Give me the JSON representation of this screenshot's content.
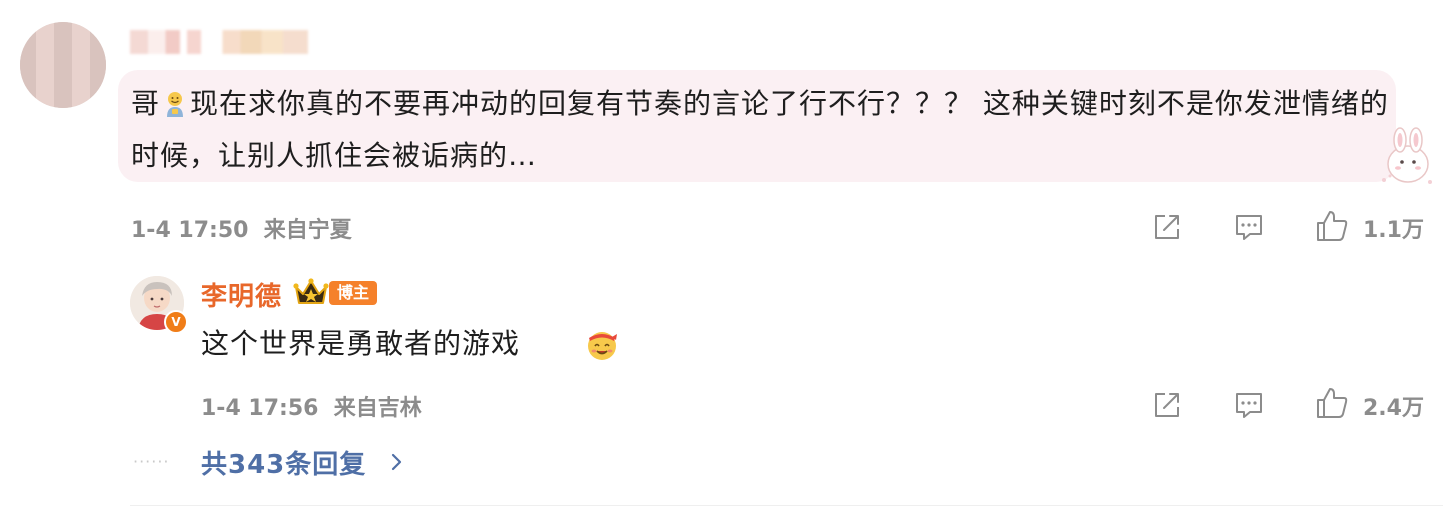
{
  "comment": {
    "text_part1": "哥",
    "text_part2": "现在求你真的不要再冲动的回复有节奏的言论了行不行？？？ 这种关键时刻不是你发泄情绪的时候，让别人抓住会被诟病的…",
    "time": "1-4 17:50",
    "location": "来自宁夏",
    "likes": "1.1万",
    "icons": {
      "share": "share-icon",
      "comment": "comment-icon",
      "like": "like-icon",
      "emoji": "smiling-emoji-icon"
    }
  },
  "reply": {
    "author": "李明德",
    "badge": "博主",
    "verified_mark": "V",
    "text": "这个世界是勇敢者的游戏",
    "time": "1-4 17:56",
    "location": "来自吉林",
    "likes": "2.4万",
    "icons": {
      "crown": "crown-icon",
      "emoji": "cheering-emoji-icon"
    }
  },
  "more": {
    "dots": "······",
    "label": "共343条回复"
  },
  "colors": {
    "author_name": "#e8672a",
    "author_badge": "#f5812b",
    "more_link": "#4f6fa6",
    "bubble_bg": "#fbf0f3",
    "meta_text": "#8c8c8c"
  }
}
